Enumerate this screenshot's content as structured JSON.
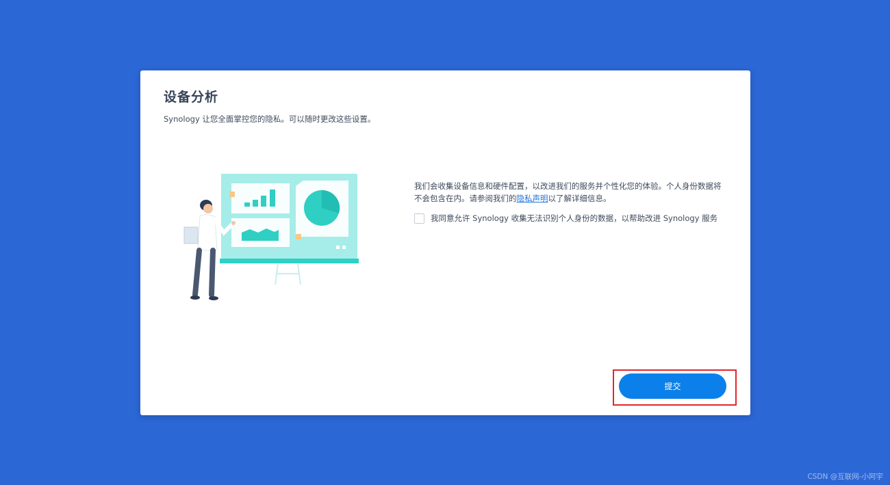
{
  "dialog": {
    "title": "设备分析",
    "subtitle": "Synology 让您全面掌控您的隐私。可以随时更改这些设置。",
    "info": {
      "text_before_link": "我们会收集设备信息和硬件配置，以改进我们的服务并个性化您的体验。个人身份数据将不会包含在内。请参阅我们的",
      "link_label": "隐私声明",
      "text_after_link": "以了解详细信息。"
    },
    "consent": {
      "checked": false,
      "label": "我同意允许 Synology 收集无法识别个人身份的数据，以帮助改进 Synology 服务"
    },
    "submit_label": "提交",
    "illustration": "presenter-with-dashboard-board",
    "highlight_color": "#e0262b"
  },
  "watermark": "CSDN @互联网-小阿宇",
  "colors": {
    "background": "#2c67d6",
    "accent": "#0b80ea",
    "board": "#a6ede9",
    "chart_teal": "#2fcfc4"
  }
}
